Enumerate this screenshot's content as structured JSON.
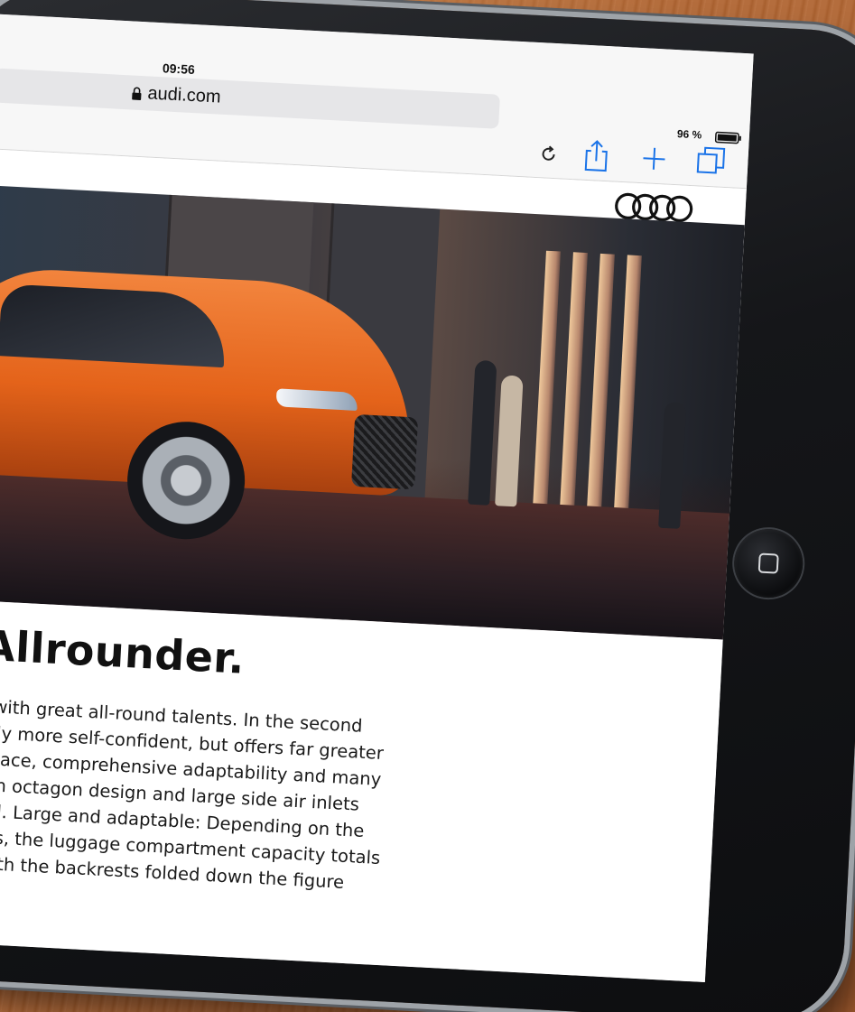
{
  "status_bar": {
    "time": "09:56",
    "battery": "96 %"
  },
  "browser": {
    "url": "audi.com",
    "icons": [
      "lock-icon",
      "reload-icon",
      "share-icon",
      "add-icon",
      "tabs-icon"
    ]
  },
  "site": {
    "logo": "audi-rings-logo"
  },
  "article": {
    "title": "Allrounder.",
    "body_lines": [
      "ily SUV with great all-round talents. In the second",
      "ly visually more self-confident, but offers far greater",
      "ndant space, comprehensive adaptability and many",
      "eframe in octagon design and large side air inlets",
      "front-end. Large and adaptable: Depending on the",
      "backrests, the luggage compartment capacity totals",
      "cu ft). With the backrests folded down the figure"
    ]
  },
  "colors": {
    "car_orange": "#e4631a",
    "ios_blue": "#1a73e8",
    "text": "#111111"
  }
}
